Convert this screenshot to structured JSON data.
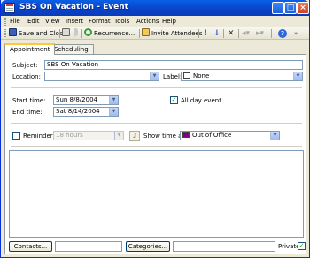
{
  "window": {
    "title": "SBS On Vacation - Event",
    "controls": {
      "minimize": "_",
      "maximize": "□",
      "close": "×"
    }
  },
  "menu": [
    "File",
    "Edit",
    "View",
    "Insert",
    "Format",
    "Tools",
    "Actions",
    "Help"
  ],
  "toolbar": {
    "save_close": "Save and Close",
    "recurrence": "Recurrence...",
    "invite": "Invite Attendees",
    "help_glyph": "?"
  },
  "tabs": [
    {
      "label": "Appointment",
      "active": true
    },
    {
      "label": "Scheduling",
      "active": false
    }
  ],
  "form": {
    "subject_label": "Subject:",
    "subject_value": "SBS On Vacation",
    "location_label": "Location:",
    "location_value": "",
    "label_label": "Label:",
    "label_value": "None",
    "start_label": "Start time:",
    "start_value": "Sun 8/8/2004",
    "end_label": "End time:",
    "end_value": "Sat 8/14/2004",
    "allday_label": "All day event",
    "allday_checked": true,
    "reminder_label": "Reminder:",
    "reminder_checked": false,
    "reminder_value": "18 hours",
    "showtime_label": "Show time as:",
    "showtime_value": "Out of Office",
    "showtime_color": "#800080"
  },
  "footer": {
    "contacts_button": "Contacts...",
    "contacts_value": "",
    "categories_button": "Categories...",
    "categories_value": "",
    "private_label": "Private",
    "private_checked": true
  }
}
